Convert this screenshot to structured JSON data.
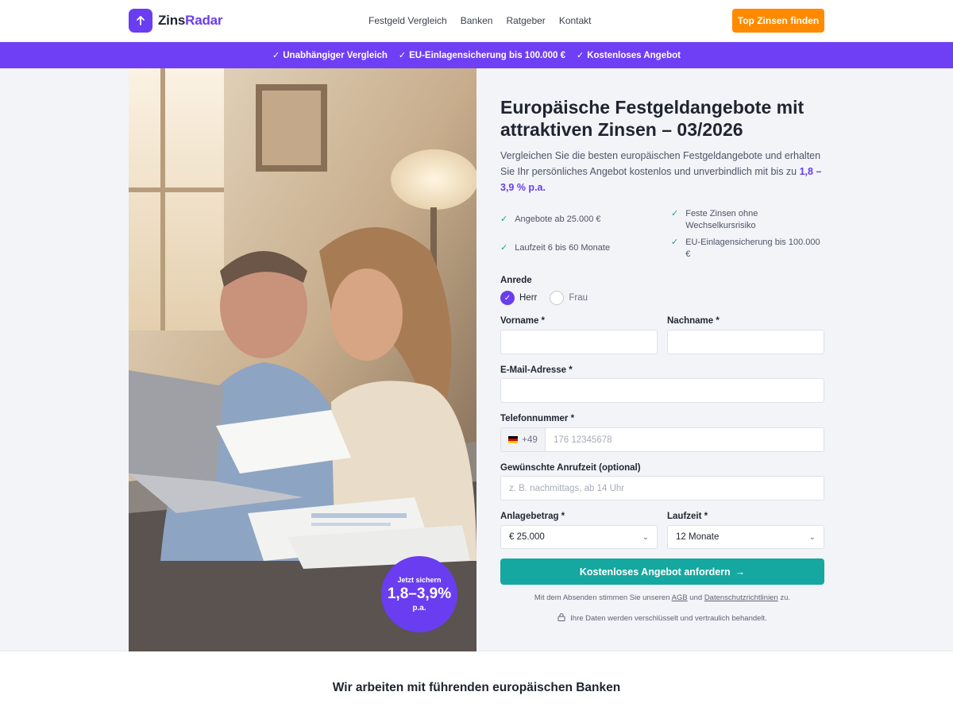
{
  "brand": {
    "name_part1": "Zins",
    "name_part2": "Radar",
    "accent_color": "#6a3df0"
  },
  "nav": {
    "items": [
      "Festgeld Vergleich",
      "Banken",
      "Ratgeber",
      "Kontakt"
    ]
  },
  "header_cta": "Top Zinsen finden",
  "strip": {
    "items": [
      "Unabhängiger Vergleich",
      "EU-Einlagensicherung bis 100.000 €",
      "Kostenloses Angebot"
    ]
  },
  "badge": {
    "line1": "Jetzt sichern",
    "line2": "1,8–3,9%",
    "line3": "p.a."
  },
  "hero": {
    "title": "Europäische Festgeldangebote mit attraktiven Zinsen – 03/2026",
    "lead_text": "Vergleichen Sie die besten europäischen Festgeldangebote und erhalten Sie Ihr persönliches Angebot kostenlos und unverbindlich mit bis zu ",
    "lead_highlight": "1,8 – 3,9 % p.a."
  },
  "features": [
    "Angebote ab 25.000 €",
    "Feste Zinsen ohne Wechselkursrisiko",
    "Laufzeit 6 bis 60 Monate",
    "EU-Einlagensicherung bis 100.000 €"
  ],
  "form": {
    "salutation_label": "Anrede",
    "salutation_options": [
      "Herr",
      "Frau"
    ],
    "salutation_selected": "Herr",
    "firstname_label": "Vorname *",
    "firstname_value": "",
    "lastname_label": "Nachname *",
    "lastname_value": "",
    "email_label": "E-Mail-Adresse *",
    "email_value": "",
    "phone_label": "Telefonnummer *",
    "phone_prefix": "+49",
    "phone_placeholder": "176 12345678",
    "calltime_label": "Gewünschte Anrufzeit (optional)",
    "calltime_placeholder": "z. B. nachmittags, ab 14 Uhr",
    "amount_label": "Anlagebetrag *",
    "amount_value": "€ 25.000",
    "term_label": "Laufzeit *",
    "term_value": "12 Monate",
    "submit_label": "Kostenloses Angebot anfordern",
    "consent_prefix": "Mit dem Absenden stimmen Sie unseren ",
    "consent_agb": "AGB",
    "consent_mid": " und ",
    "consent_privacy": "Datenschutzrichtlinien",
    "consent_suffix": " zu.",
    "secure_text": "Ihre Daten werden verschlüsselt und vertraulich behandelt."
  },
  "banks_title": "Wir arbeiten mit führenden europäischen Banken",
  "colors": {
    "orange": "#ff8a00",
    "purple": "#6f3ff5",
    "teal": "#15a8a0",
    "check": "#16a394"
  }
}
